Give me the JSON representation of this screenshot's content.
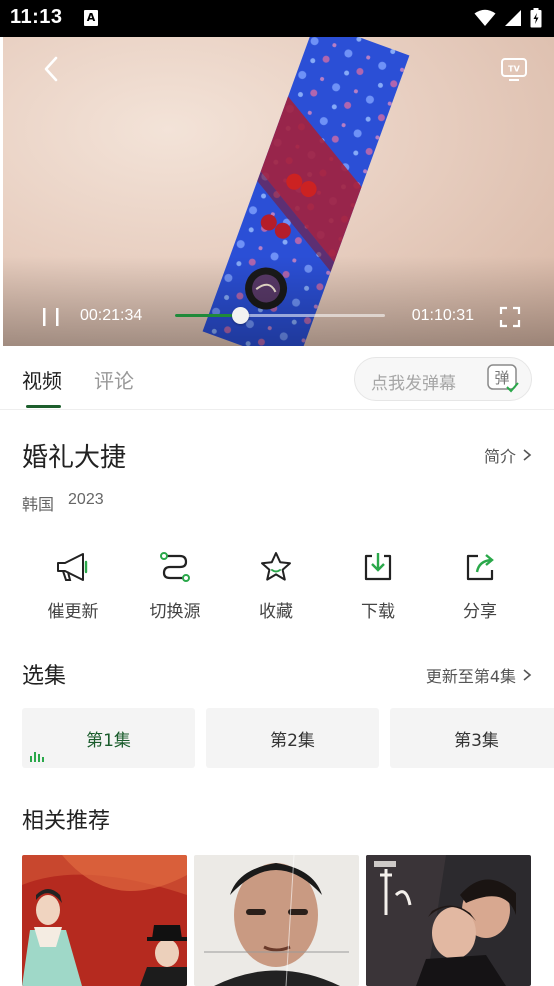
{
  "status_bar": {
    "time": "11:13",
    "notification_glyph": "A"
  },
  "player": {
    "current_time": "00:21:34",
    "total_time": "01:10:31",
    "progress": 0.31,
    "accent_color": "#1f8a3a"
  },
  "tabs": {
    "video": "视频",
    "comment": "评论",
    "danmaku_placeholder": "点我发弹幕",
    "danmaku_button": "弹"
  },
  "show": {
    "title": "婚礼大捷",
    "intro_label": "简介",
    "region": "韩国",
    "year": "2023"
  },
  "actions": [
    {
      "label": "催更新",
      "icon": "megaphone-icon"
    },
    {
      "label": "切换源",
      "icon": "switch-source-icon"
    },
    {
      "label": "收藏",
      "icon": "star-icon"
    },
    {
      "label": "下载",
      "icon": "download-icon"
    },
    {
      "label": "分享",
      "icon": "share-icon"
    }
  ],
  "episodes": {
    "title": "选集",
    "update_status": "更新至第4集",
    "items": [
      "第1集",
      "第2集",
      "第3集"
    ]
  },
  "recommend": {
    "title": "相关推荐"
  }
}
